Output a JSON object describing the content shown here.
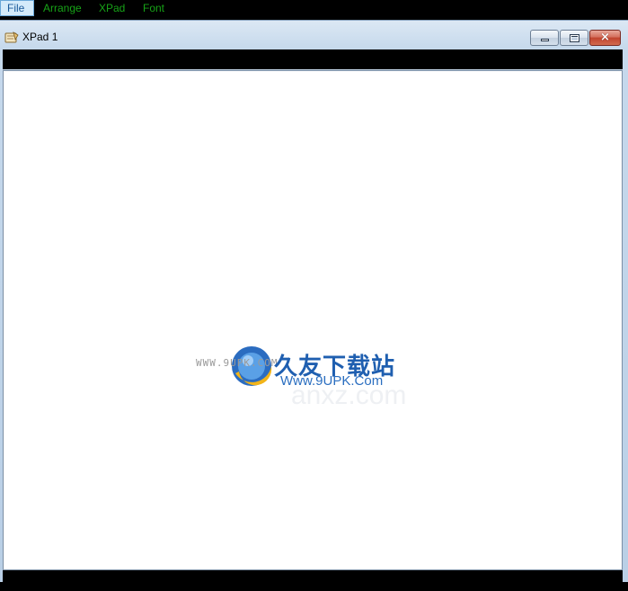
{
  "menubar": {
    "items": [
      {
        "label": "File",
        "active": true
      },
      {
        "label": "Arrange",
        "active": false
      },
      {
        "label": "XPad",
        "active": false
      },
      {
        "label": "Font",
        "active": false
      }
    ]
  },
  "window": {
    "title": "XPad 1",
    "close_glyph": "×"
  },
  "watermark": {
    "prefix": "WWW.9UPK.COM",
    "brand": "久友下载站",
    "url": "Www.9UPK.Com",
    "faint": "anxz.com"
  },
  "colors": {
    "menu_text": "#17a317",
    "menu_active_bg": "#d4ebfa",
    "brand_blue": "#1f5fb0"
  }
}
